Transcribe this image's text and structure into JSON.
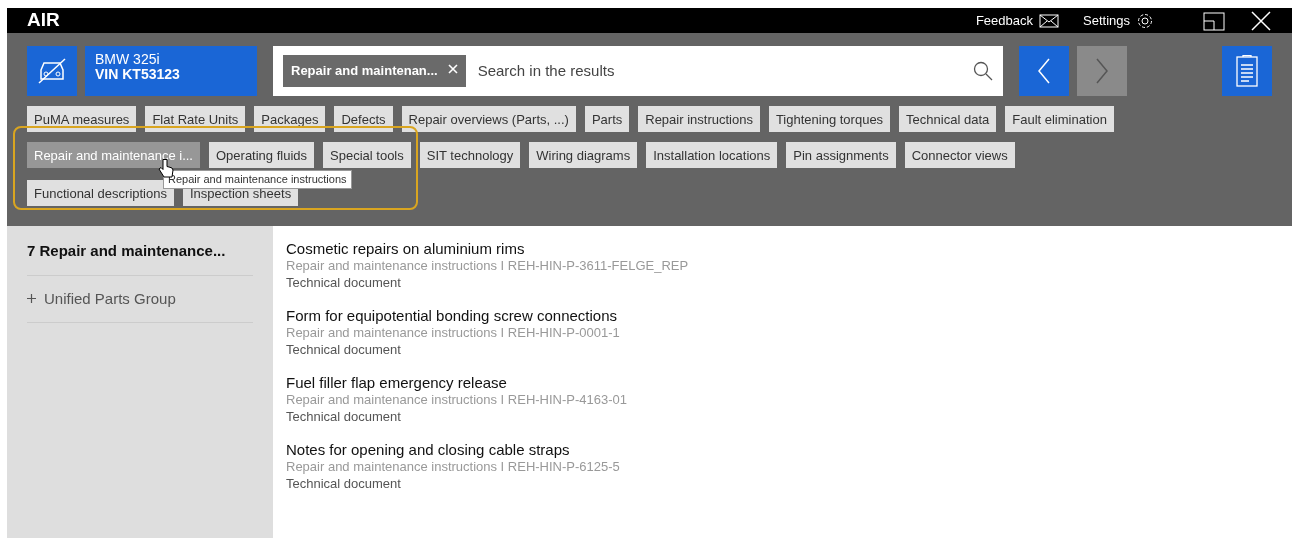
{
  "app": {
    "title": "AIR",
    "feedback": "Feedback",
    "settings": "Settings"
  },
  "vehicle": {
    "model": "BMW 325i",
    "vin": "VIN KT53123"
  },
  "search": {
    "filter_chip": "Repair and maintenan...",
    "placeholder": "Search in the results"
  },
  "nav": {
    "back_disabled": false,
    "forward_disabled": true
  },
  "filters": [
    [
      {
        "label": "PuMA measures",
        "selected": false
      },
      {
        "label": "Flat Rate Units",
        "selected": false
      },
      {
        "label": "Packages",
        "selected": false
      },
      {
        "label": "Defects",
        "selected": false
      },
      {
        "label": "Repair overviews (Parts, ...)",
        "selected": false
      },
      {
        "label": "Parts",
        "selected": false
      },
      {
        "label": "Repair instructions",
        "selected": false
      },
      {
        "label": "Tightening torques",
        "selected": false
      },
      {
        "label": "Technical data",
        "selected": false
      },
      {
        "label": "Fault elimination",
        "selected": false
      }
    ],
    [
      {
        "label": "Repair and maintenance i...",
        "selected": true
      },
      {
        "label": "Operating fluids",
        "selected": false
      },
      {
        "label": "Special tools",
        "selected": false
      },
      {
        "label": "SIT technology",
        "selected": false
      },
      {
        "label": "Wiring diagrams",
        "selected": false
      },
      {
        "label": "Installation locations",
        "selected": false
      },
      {
        "label": "Pin assignments",
        "selected": false
      },
      {
        "label": "Connector views",
        "selected": false
      }
    ],
    [
      {
        "label": "Functional descriptions",
        "selected": false
      },
      {
        "label": "Inspection sheets",
        "selected": false
      }
    ]
  ],
  "tooltip": "Repair and maintenance instructions",
  "sidebar": {
    "heading": "7 Repair and maintenance...",
    "items": [
      {
        "label": "Unified Parts Group",
        "expanded": false
      }
    ]
  },
  "results": [
    {
      "title": "Cosmetic repairs on aluminium rims",
      "source": "Repair and maintenance instructions I REH-HIN-P-3611-FELGE_REP",
      "type": "Technical document"
    },
    {
      "title": "Form for equipotential bonding screw connections",
      "source": "Repair and maintenance instructions I REH-HIN-P-0001-1",
      "type": "Technical document"
    },
    {
      "title": "Fuel filler flap emergency release",
      "source": "Repair and maintenance instructions I REH-HIN-P-4163-01",
      "type": "Technical document"
    },
    {
      "title": "Notes for opening and closing cable straps",
      "source": "Repair and maintenance instructions I REH-HIN-P-6125-5",
      "type": "Technical document"
    }
  ]
}
